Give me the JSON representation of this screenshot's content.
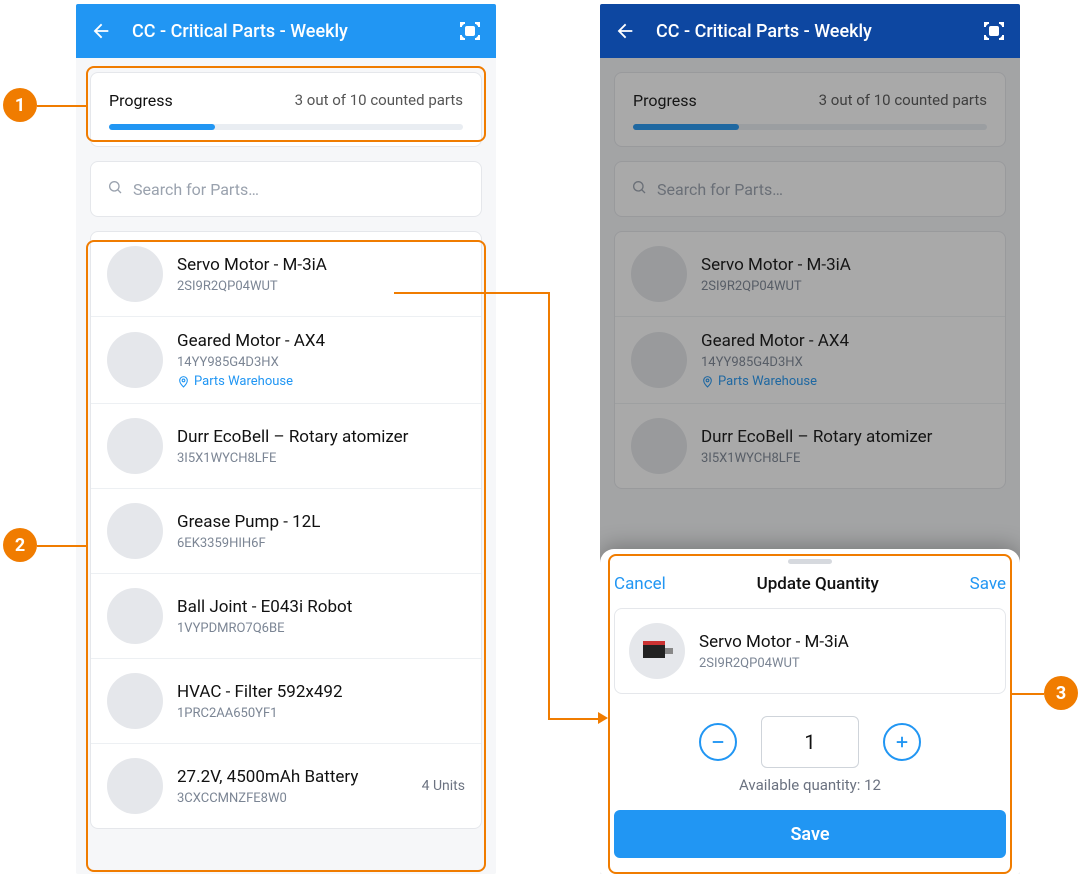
{
  "annotations": {
    "1": "1",
    "2": "2",
    "3": "3"
  },
  "header": {
    "title": "CC - Critical Parts - Weekly"
  },
  "progress": {
    "label": "Progress",
    "status": "3 out of 10 counted parts",
    "percent": 30
  },
  "search": {
    "placeholder": "Search for Parts…"
  },
  "parts": [
    {
      "name": "Servo Motor - M-3iA",
      "code": "2SI9R2QP04WUT"
    },
    {
      "name": "Geared Motor - AX4",
      "code": "14YY985G4D3HX",
      "location": "Parts Warehouse"
    },
    {
      "name": "Durr EcoBell – Rotary atomizer",
      "code": "3I5X1WYCH8LFE"
    },
    {
      "name": "Grease Pump - 12L",
      "code": "6EK3359HIH6F"
    },
    {
      "name": "Ball Joint - E043i Robot",
      "code": "1VYPDMRO7Q6BE"
    },
    {
      "name": "HVAC - Filter 592x492",
      "code": "1PRC2AA650YF1"
    },
    {
      "name": "27.2V, 4500mAh Battery",
      "code": "3CXCCMNZFE8W0",
      "units": "4 Units"
    }
  ],
  "sheet": {
    "cancel": "Cancel",
    "title": "Update Quantity",
    "save_link": "Save",
    "part_name": "Servo Motor - M-3iA",
    "part_code": "2SI9R2QP04WUT",
    "qty": "1",
    "available": "Available quantity: 12",
    "save_btn": "Save"
  }
}
